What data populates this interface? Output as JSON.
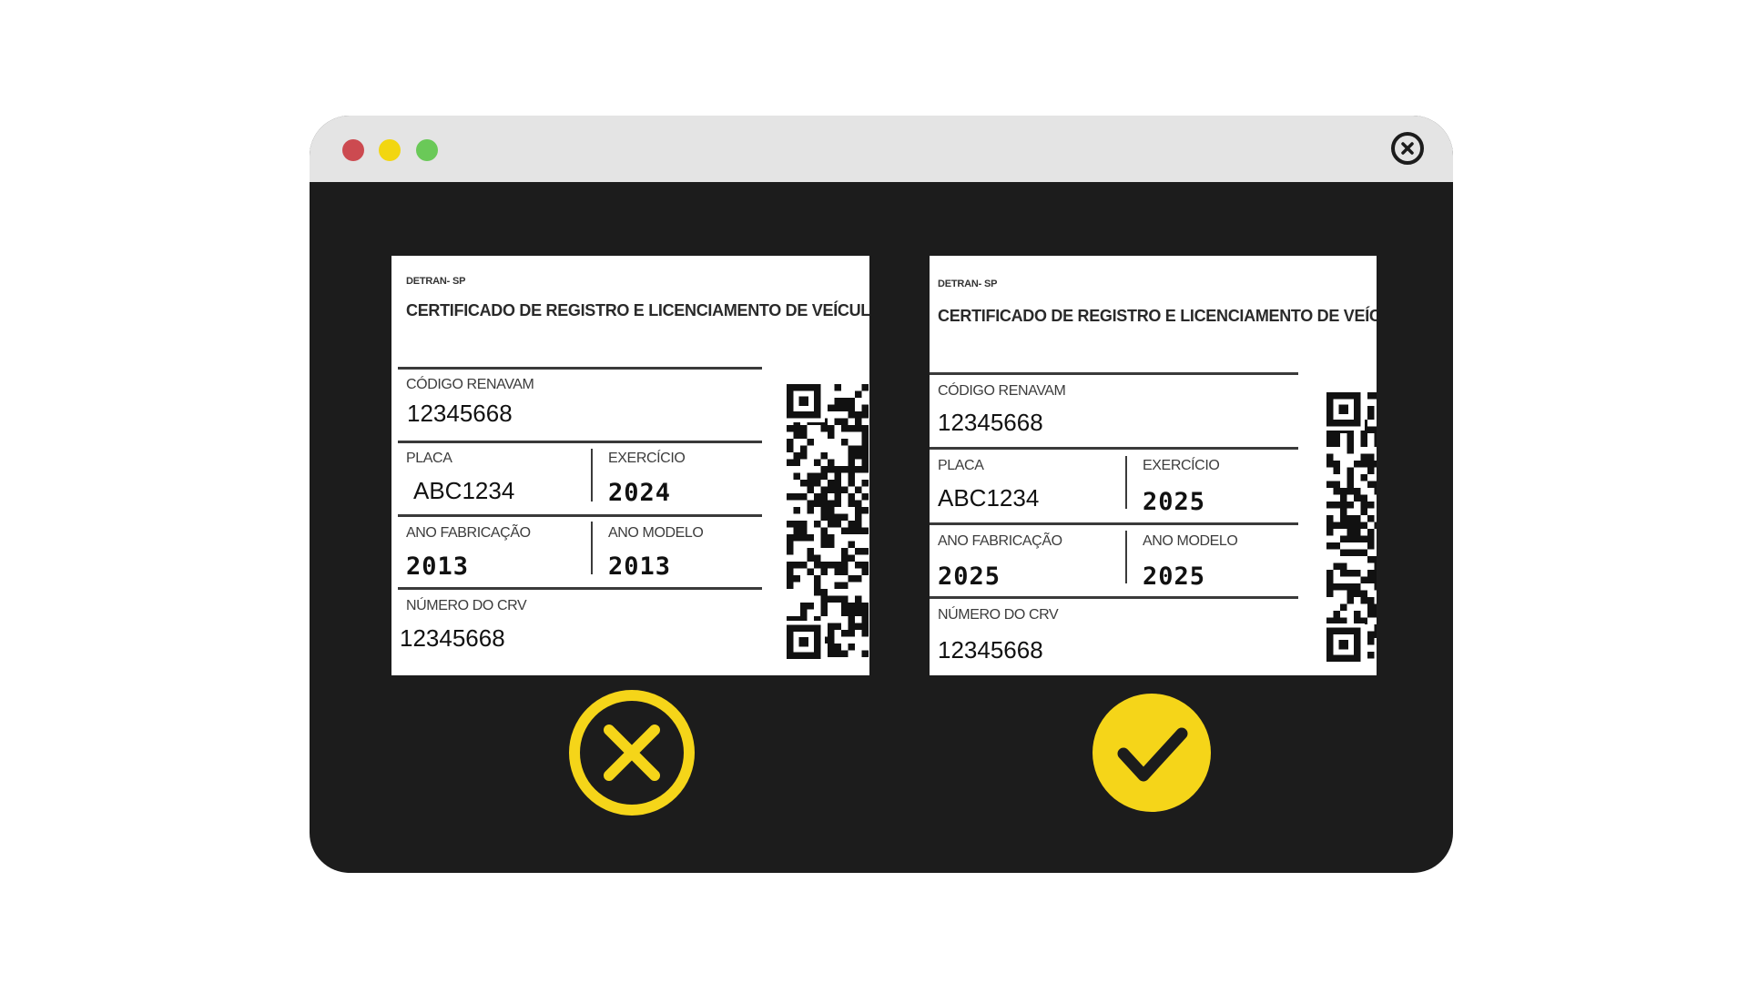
{
  "window": {
    "controls": [
      "close-red",
      "minimize-yellow",
      "maximize-green"
    ],
    "close_icon": "close-circle-icon"
  },
  "colors": {
    "accent": "#f5d519",
    "frame": "#1c1c1c",
    "titlebar": "#e4e4e4"
  },
  "cards": [
    {
      "status": "incorrect",
      "status_icon": "x-circle-icon",
      "issuer": "DETRAN- SP",
      "heading": "CERTIFICADO DE REGISTRO E LICENCIAMENTO DE VEÍCULO",
      "renavam_label": "CÓDIGO RENAVAM",
      "renavam_value": "12345668",
      "placa_label": "PLACA",
      "placa_value": "ABC1234",
      "exercicio_label": "EXERCÍCIO",
      "exercicio_value": "2024",
      "ano_fabricacao_label": "ANO FABRICAÇÃO",
      "ano_fabricacao_value": "2013",
      "ano_modelo_label": "ANO MODELO",
      "ano_modelo_value": "2013",
      "crv_label": "NÚMERO DO CRV",
      "crv_value": "12345668"
    },
    {
      "status": "correct",
      "status_icon": "check-circle-icon",
      "issuer": "DETRAN- SP",
      "heading": "CERTIFICADO DE REGISTRO E LICENCIAMENTO DE VEÍCULO",
      "renavam_label": "CÓDIGO RENAVAM",
      "renavam_value": "12345668",
      "placa_label": "PLACA",
      "placa_value": "ABC1234",
      "exercicio_label": "EXERCÍCIO",
      "exercicio_value": "2025",
      "ano_fabricacao_label": "ANO FABRICAÇÃO",
      "ano_fabricacao_value": "2025",
      "ano_modelo_label": "ANO MODELO",
      "ano_modelo_value": "2025",
      "crv_label": "NÚMERO DO CRV",
      "crv_value": "12345668"
    }
  ]
}
